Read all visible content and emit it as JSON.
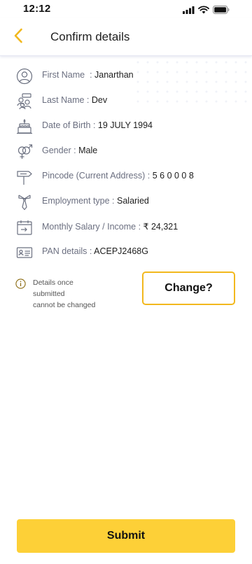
{
  "status_bar": {
    "time": "12:12",
    "icons": [
      "signal-icon",
      "wifi-icon",
      "battery-icon"
    ]
  },
  "header": {
    "title": "Confirm details",
    "back_icon": "chevron-left-icon"
  },
  "colors": {
    "accent": "#f2b81d",
    "submit_bg": "#fdd037",
    "icon_stroke": "#6b7080"
  },
  "details": [
    {
      "icon": "user-icon",
      "label": "First Name",
      "sep": "  : ",
      "value": "Janarthan"
    },
    {
      "icon": "group-icon",
      "label": "Last Name",
      "sep": " : ",
      "value": "Dev"
    },
    {
      "icon": "cake-icon",
      "label": "Date of Birth",
      "sep": " : ",
      "value": "19 JULY 1994"
    },
    {
      "icon": "gender-icon",
      "label": "Gender",
      "sep": " : ",
      "value": "Male"
    },
    {
      "icon": "signpost-icon",
      "label": "Pincode (Current Address)",
      "sep": " : ",
      "value": "5 6 0 0 0 8"
    },
    {
      "icon": "tie-icon",
      "label": "Employment type",
      "sep": " : ",
      "value": "Salaried"
    },
    {
      "icon": "calendar-income-icon",
      "label": "Monthly Salary / Income",
      "sep": " : ",
      "value": "₹ 24,321"
    },
    {
      "icon": "id-card-icon",
      "label": "PAN details",
      "sep": " : ",
      "value": "ACEPJ2468G"
    }
  ],
  "info": {
    "icon": "info-icon",
    "lines": [
      "Details once",
      "submitted",
      "cannot be changed"
    ]
  },
  "change_button": "Change?",
  "submit_button": "Submit"
}
